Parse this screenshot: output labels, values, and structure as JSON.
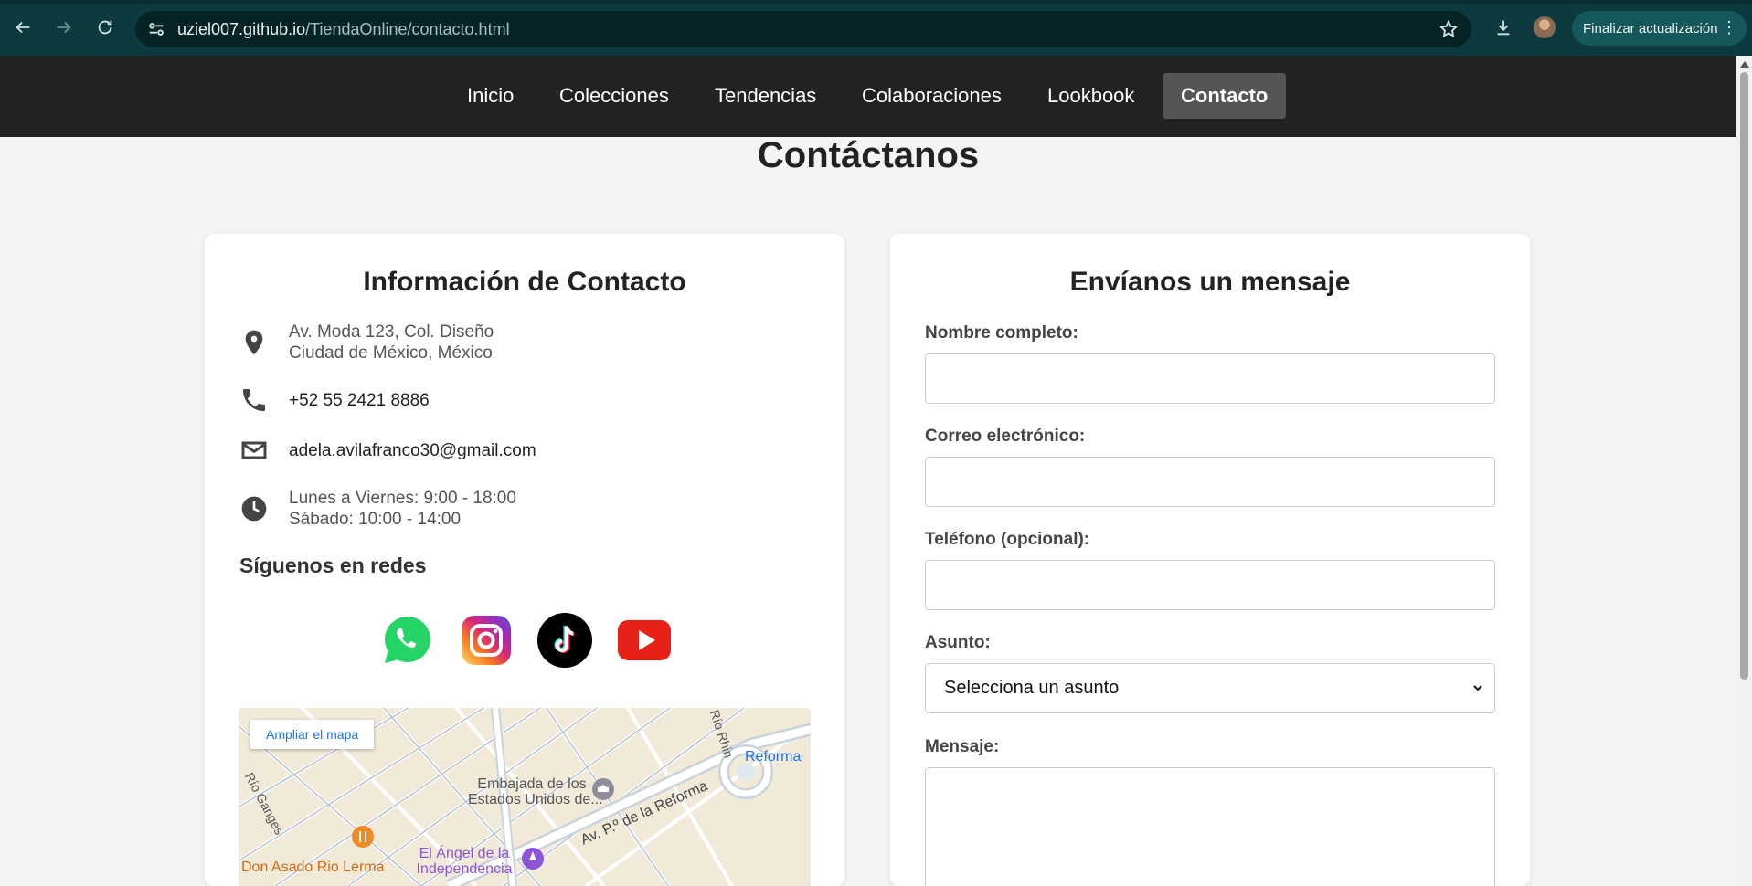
{
  "browser": {
    "url_host": "uziel007.github.io",
    "url_path": "/TiendaOnline/contacto.html",
    "update_button": "Finalizar actualización"
  },
  "nav": {
    "items": [
      {
        "label": "Inicio"
      },
      {
        "label": "Colecciones"
      },
      {
        "label": "Tendencias"
      },
      {
        "label": "Colaboraciones"
      },
      {
        "label": "Lookbook"
      },
      {
        "label": "Contacto",
        "active": true
      }
    ]
  },
  "page": {
    "title": "Contáctanos"
  },
  "contact_info": {
    "heading": "Información de Contacto",
    "address_line1": "Av. Moda 123, Col. Diseño",
    "address_line2": "Ciudad de México, México",
    "phone": "+52 55 2421 8886",
    "email": "adela.avilafranco30@gmail.com",
    "hours_line1": "Lunes a Viernes: 9:00 - 18:00",
    "hours_line2": "Sábado: 10:00 - 14:00",
    "social_heading": "Síguenos en redes",
    "social_icons": [
      "whatsapp-icon",
      "instagram-icon",
      "tiktok-icon",
      "youtube-icon"
    ]
  },
  "map": {
    "enlarge_button": "Ampliar el mapa",
    "labels": {
      "embassy_line1": "Embajada de los",
      "embassy_line2": "Estados Unidos de...",
      "reforma": "Reforma",
      "avenue": "Av. P.º de la Reforma",
      "angel_line1": "El Ángel de la",
      "angel_line2": "Independencia",
      "restaurant": "Don Asado Rio Lerma",
      "rio_ganges": "Río Ganges",
      "rio_rhin": "Río Rhin"
    }
  },
  "form": {
    "heading": "Envíanos un mensaje",
    "name_label": "Nombre completo:",
    "email_label": "Correo electrónico:",
    "phone_label": "Teléfono (opcional):",
    "subject_label": "Asunto:",
    "subject_selected": "Selecciona un asunto",
    "message_label": "Mensaje:"
  },
  "colors": {
    "navbar": "#222222",
    "nav_active": "#555555",
    "page_bg": "#f4f4f4",
    "chrome_bg": "#0d3a3e"
  }
}
